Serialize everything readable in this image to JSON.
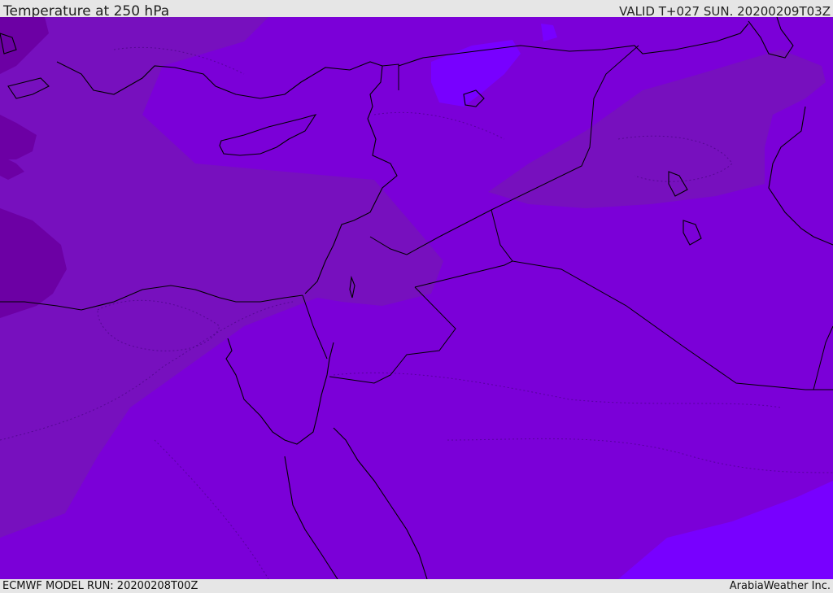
{
  "header": {
    "title": "Temperature at 250 hPa",
    "valid": "VALID T+027 SUN. 20200209T03Z"
  },
  "footer": {
    "model_run": "ECMWF MODEL RUN: 20200208T00Z",
    "credit": "ArabiaWeather Inc."
  },
  "map": {
    "variable": "temperature",
    "pressure_level_hPa": 250,
    "colors": {
      "base": "#7b00d8",
      "warm_band": "#7710be",
      "warmer_core": "#6c00a4",
      "cool_patch": "#7800ff",
      "coastline": "#000000",
      "border": "#000000"
    }
  }
}
